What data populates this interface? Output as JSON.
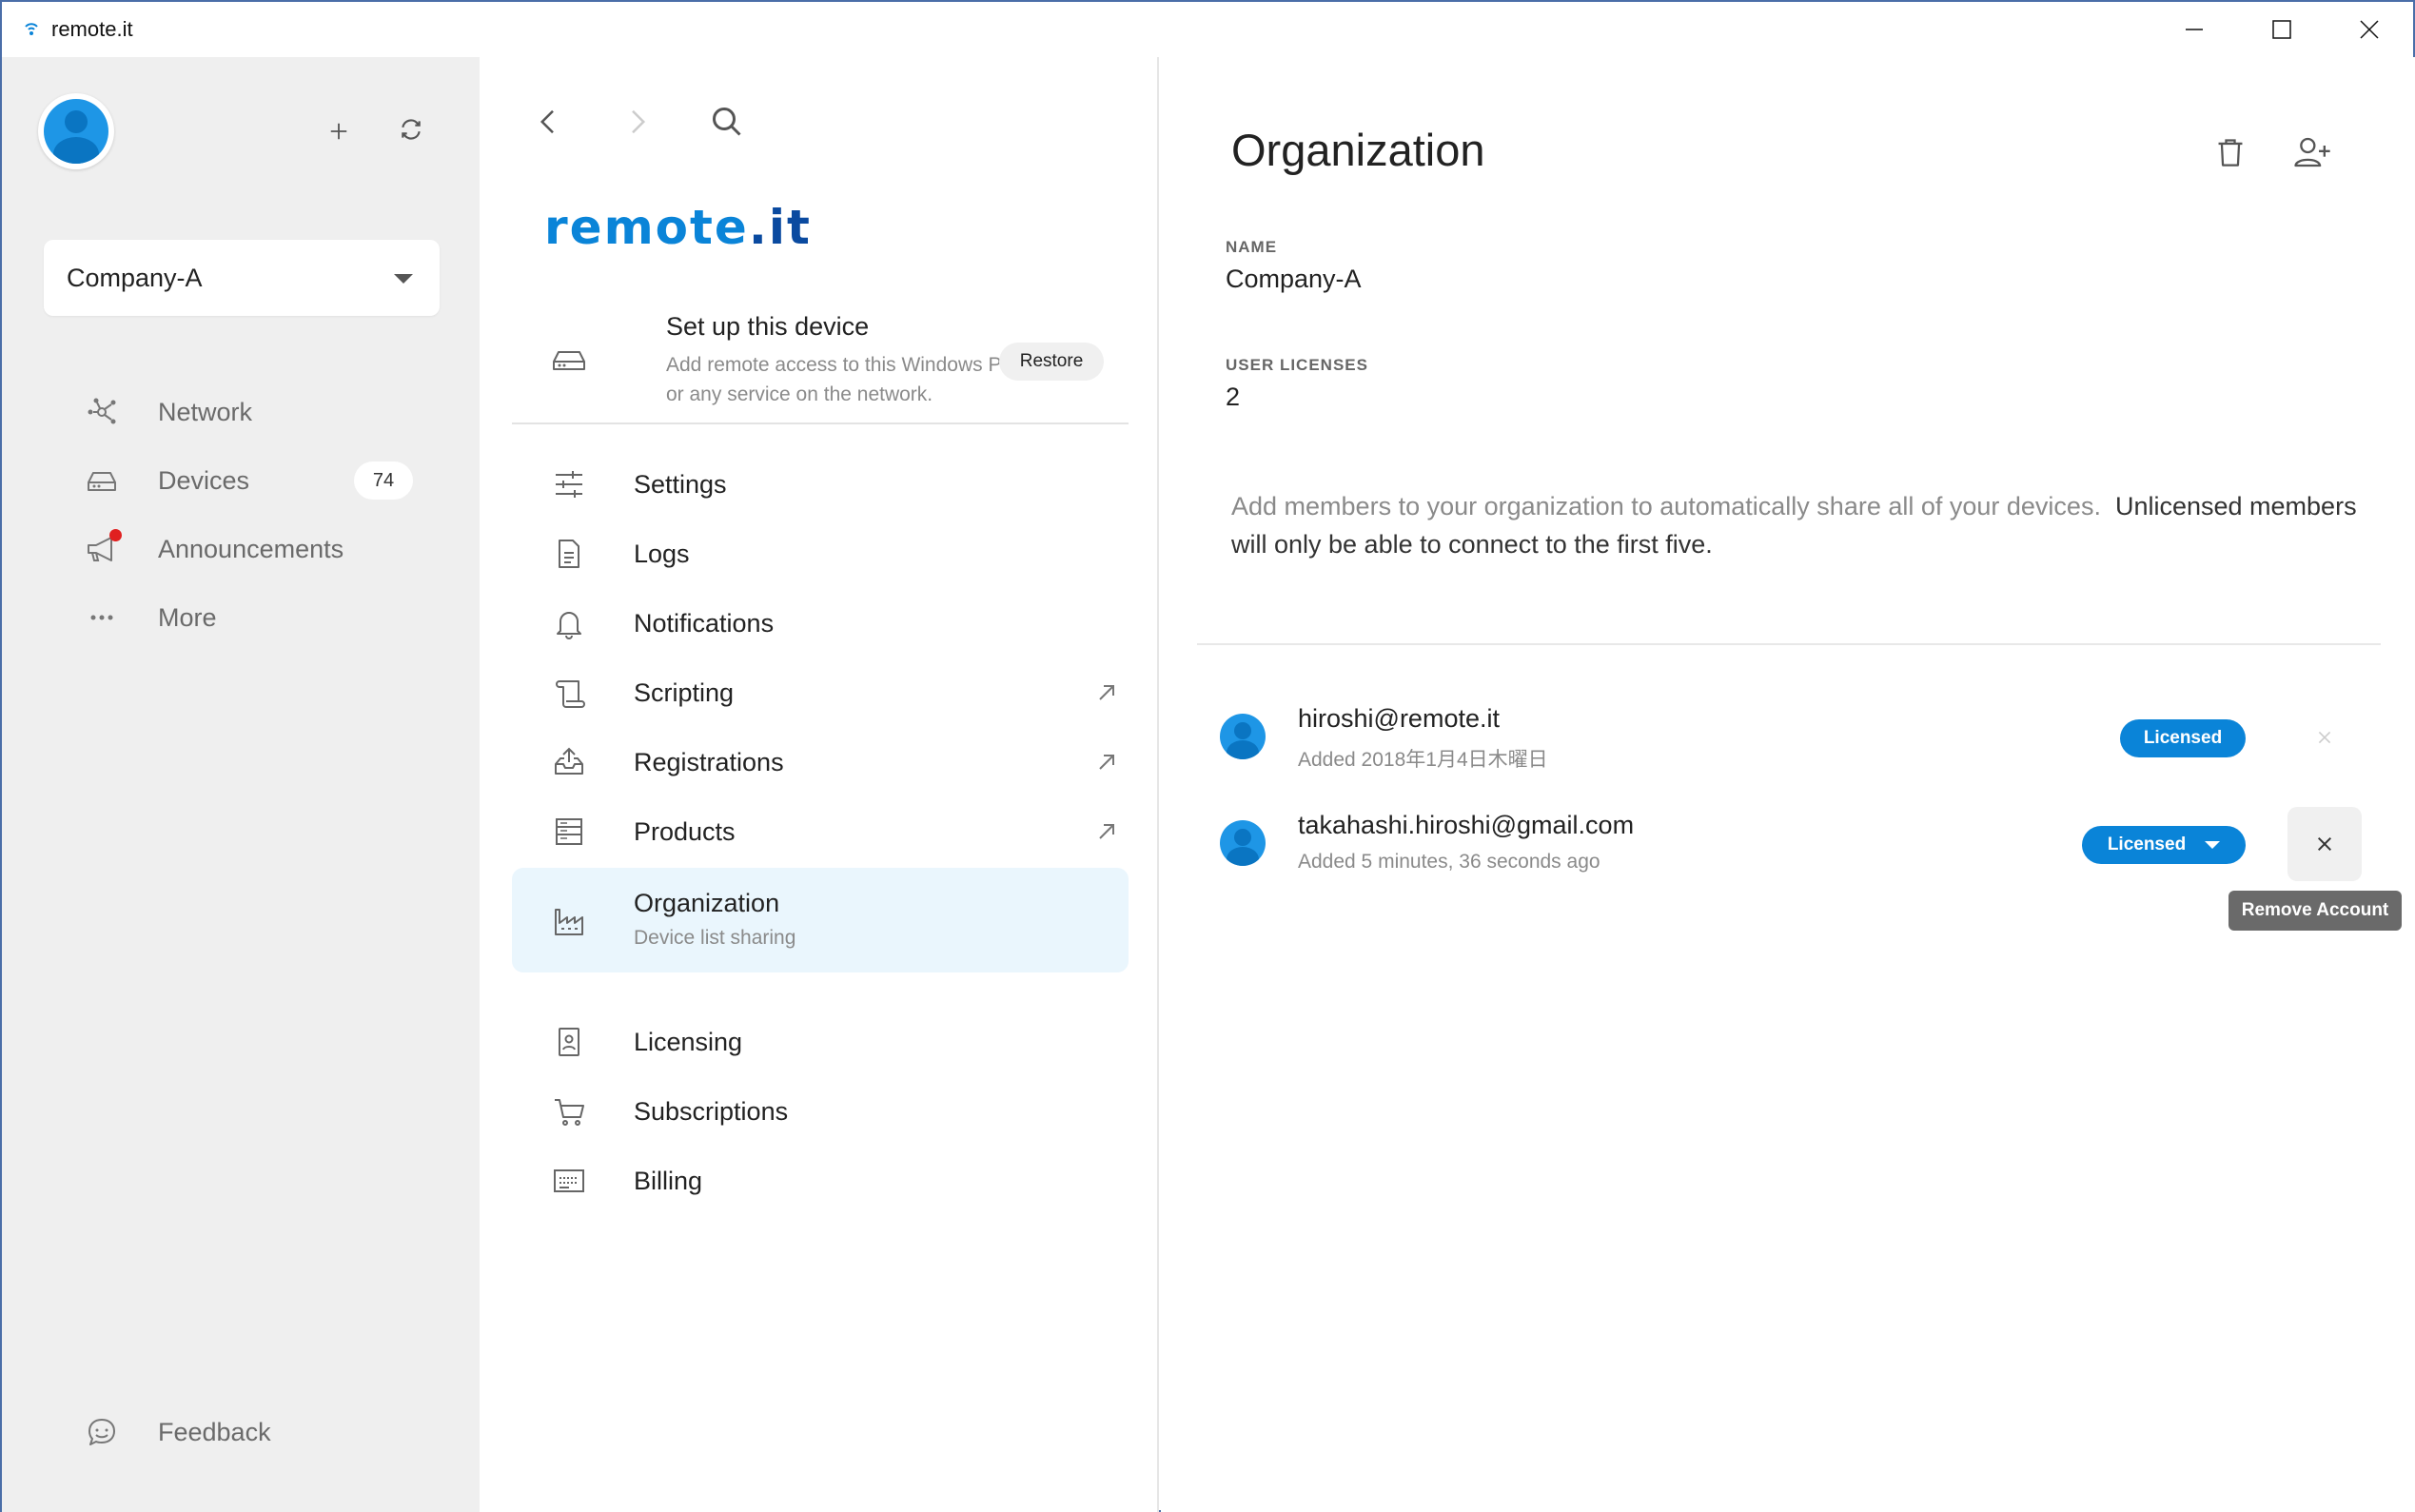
{
  "window": {
    "title": "remote.it",
    "app_icon": "remoteit-app-icon",
    "controls": [
      "minimize-icon",
      "maximize-icon",
      "close-icon"
    ]
  },
  "sidebar": {
    "organization": "Company-A",
    "nav": [
      {
        "label": "Network",
        "icon": "network-icon"
      },
      {
        "label": "Devices",
        "icon": "devices-icon",
        "count": "74"
      },
      {
        "label": "Announcements",
        "icon": "megaphone-icon",
        "has_notification": true
      },
      {
        "label": "More",
        "icon": "more-icon"
      }
    ],
    "feedback": {
      "label": "Feedback",
      "icon": "feedback-icon"
    }
  },
  "middle": {
    "logo_text": "remote",
    "logo_suffix": ".it",
    "setup": {
      "title": "Set up this device",
      "description": "Add remote access to this Windows PC or any service on the network.",
      "restore_label": "Restore"
    },
    "menu": [
      {
        "label": "Settings",
        "icon": "settings-sliders-icon",
        "external": false
      },
      {
        "label": "Logs",
        "icon": "document-icon",
        "external": false
      },
      {
        "label": "Notifications",
        "icon": "bell-icon",
        "external": false
      },
      {
        "label": "Scripting",
        "icon": "scroll-icon",
        "external": true
      },
      {
        "label": "Registrations",
        "icon": "upload-box-icon",
        "external": true
      },
      {
        "label": "Products",
        "icon": "server-rack-icon",
        "external": true
      },
      {
        "label": "Organization",
        "sublabel": "Device list sharing",
        "icon": "industry-icon",
        "external": false,
        "active": true
      },
      {
        "label": "Licensing",
        "icon": "id-badge-icon",
        "external": false
      },
      {
        "label": "Subscriptions",
        "icon": "cart-icon",
        "external": false
      },
      {
        "label": "Billing",
        "icon": "billing-card-icon",
        "external": false
      }
    ]
  },
  "content": {
    "title": "Organization",
    "name_label": "NAME",
    "name_value": "Company-A",
    "licenses_label": "USER LICENSES",
    "licenses_value": "2",
    "info_text_light": "Add members to your organization to automatically share all of your devices.",
    "info_text_dark": "Unlicensed members will only be able to connect to the first five.",
    "members": [
      {
        "email": "hiroshi@remote.it",
        "added": "Added 2018年1月4日木曜日",
        "license": "Licensed",
        "has_dropdown": false
      },
      {
        "email": "takahashi.hiroshi@gmail.com",
        "added": "Added 5 minutes, 36 seconds ago",
        "license": "Licensed",
        "has_dropdown": true
      }
    ],
    "tooltip": "Remove Account"
  }
}
